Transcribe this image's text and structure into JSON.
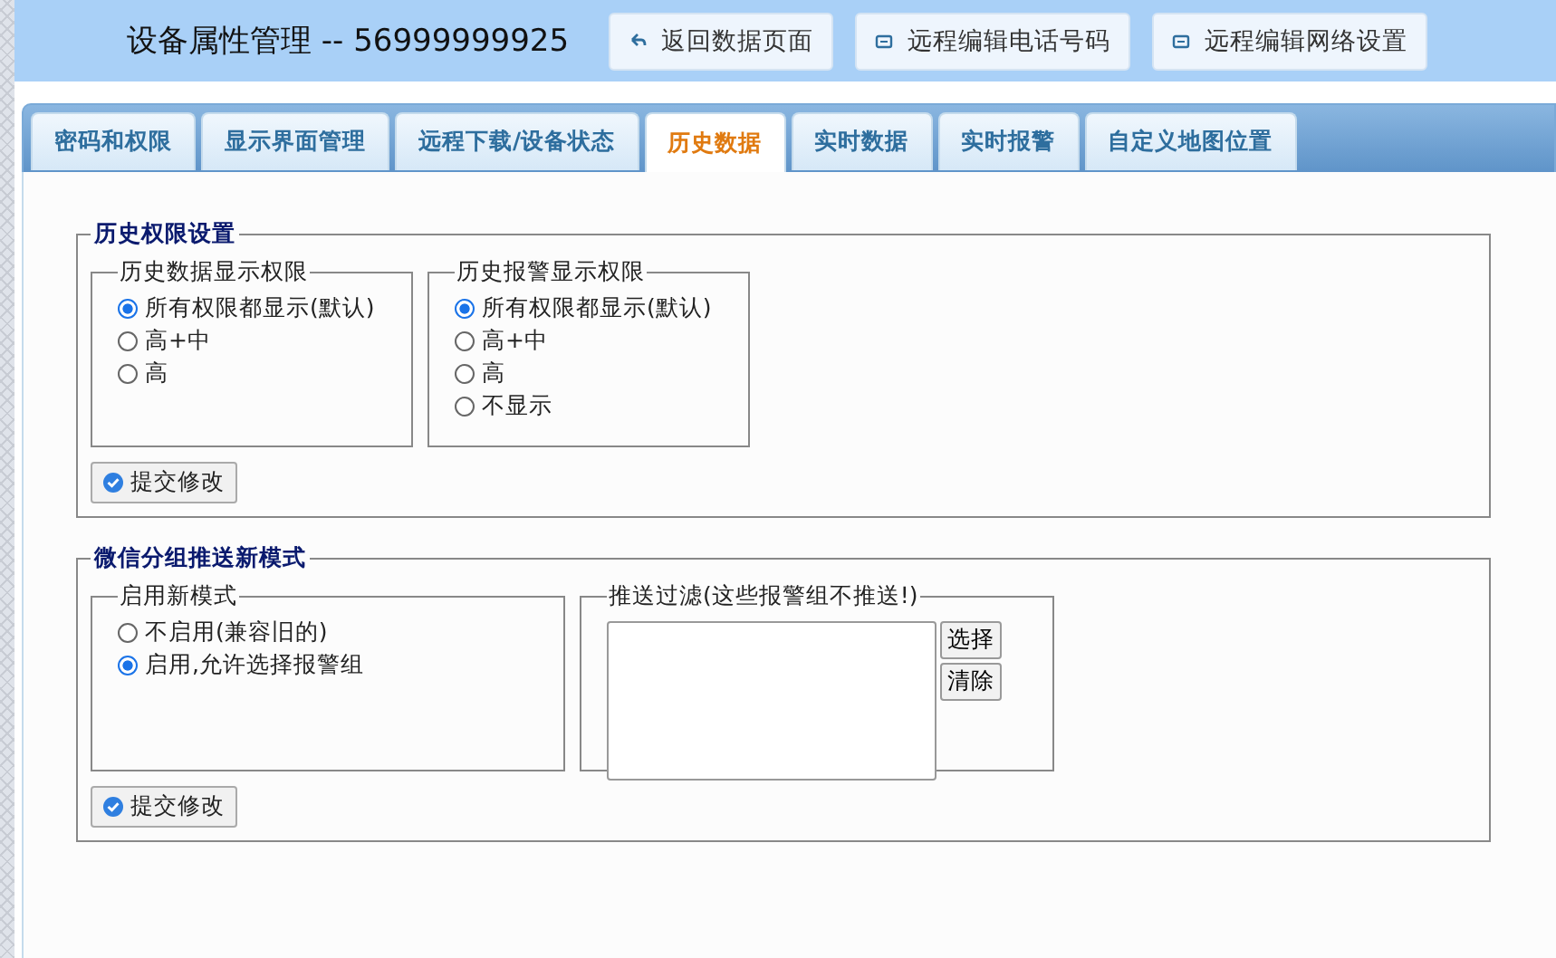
{
  "header": {
    "title": "设备属性管理 -- 56999999925",
    "buttons": [
      {
        "label": "返回数据页面",
        "kind": "back"
      },
      {
        "label": "远程编辑电话号码",
        "kind": "remote"
      },
      {
        "label": "远程编辑网络设置",
        "kind": "remote"
      }
    ]
  },
  "tabs": [
    {
      "label": "密码和权限",
      "selected": false
    },
    {
      "label": "显示界面管理",
      "selected": false
    },
    {
      "label": "远程下载/设备状态",
      "selected": false
    },
    {
      "label": "历史数据",
      "selected": true
    },
    {
      "label": "实时数据",
      "selected": false
    },
    {
      "label": "实时报警",
      "selected": false
    },
    {
      "label": "自定义地图位置",
      "selected": false
    }
  ],
  "sections": [
    {
      "legend": "历史权限设置",
      "groups": [
        {
          "kind": "radio",
          "legend": "历史数据显示权限",
          "options": [
            {
              "label": "所有权限都显示(默认)",
              "selected": true
            },
            {
              "label": "高+中",
              "selected": false
            },
            {
              "label": "高",
              "selected": false
            }
          ]
        },
        {
          "kind": "radio",
          "legend": "历史报警显示权限",
          "options": [
            {
              "label": "所有权限都显示(默认)",
              "selected": true
            },
            {
              "label": "高+中",
              "selected": false
            },
            {
              "label": "高",
              "selected": false
            },
            {
              "label": "不显示",
              "selected": false
            }
          ]
        }
      ],
      "submit": "提交修改"
    },
    {
      "legend": "微信分组推送新模式",
      "groups": [
        {
          "kind": "radio",
          "legend": "启用新模式",
          "options": [
            {
              "label": "不启用(兼容旧的)",
              "selected": false
            },
            {
              "label": "启用,允许选择报警组",
              "selected": true
            }
          ]
        },
        {
          "kind": "filter",
          "legend": "推送过滤(这些报警组不推送!)",
          "buttons": [
            "选择",
            "清除"
          ]
        }
      ],
      "submit": "提交修改"
    }
  ]
}
